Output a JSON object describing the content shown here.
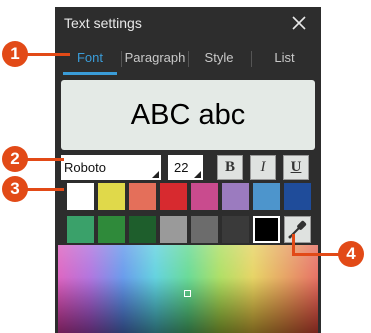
{
  "dialog": {
    "title": "Text settings",
    "close_icon": "close-icon"
  },
  "tabs": [
    {
      "label": "Font",
      "active": true
    },
    {
      "label": "Paragraph",
      "active": false
    },
    {
      "label": "Style",
      "active": false
    },
    {
      "label": "List",
      "active": false
    }
  ],
  "preview": {
    "text": "ABC abc"
  },
  "font": {
    "family": "Roboto",
    "size": "22"
  },
  "format_buttons": {
    "bold": "B",
    "italic": "I",
    "underline": "U"
  },
  "palette": {
    "row1": [
      "#ffffff",
      "#e0d94a",
      "#e46f5a",
      "#d72a2f",
      "#c94b8e",
      "#9b7bbf",
      "#4d95cc",
      "#1f4c9a"
    ],
    "row2": [
      "#3aa16a",
      "#2f8a3a",
      "#1e5e2c",
      "#9a9a9a",
      "#6c6c6c",
      "#3a3a3a",
      "#000000"
    ],
    "selected": "#000000",
    "eyedropper_icon": "eyedropper-icon"
  },
  "annotations": [
    "1",
    "2",
    "3",
    "4"
  ],
  "colors": {
    "accent": "#3a9cd8",
    "callout": "#e24a17"
  }
}
